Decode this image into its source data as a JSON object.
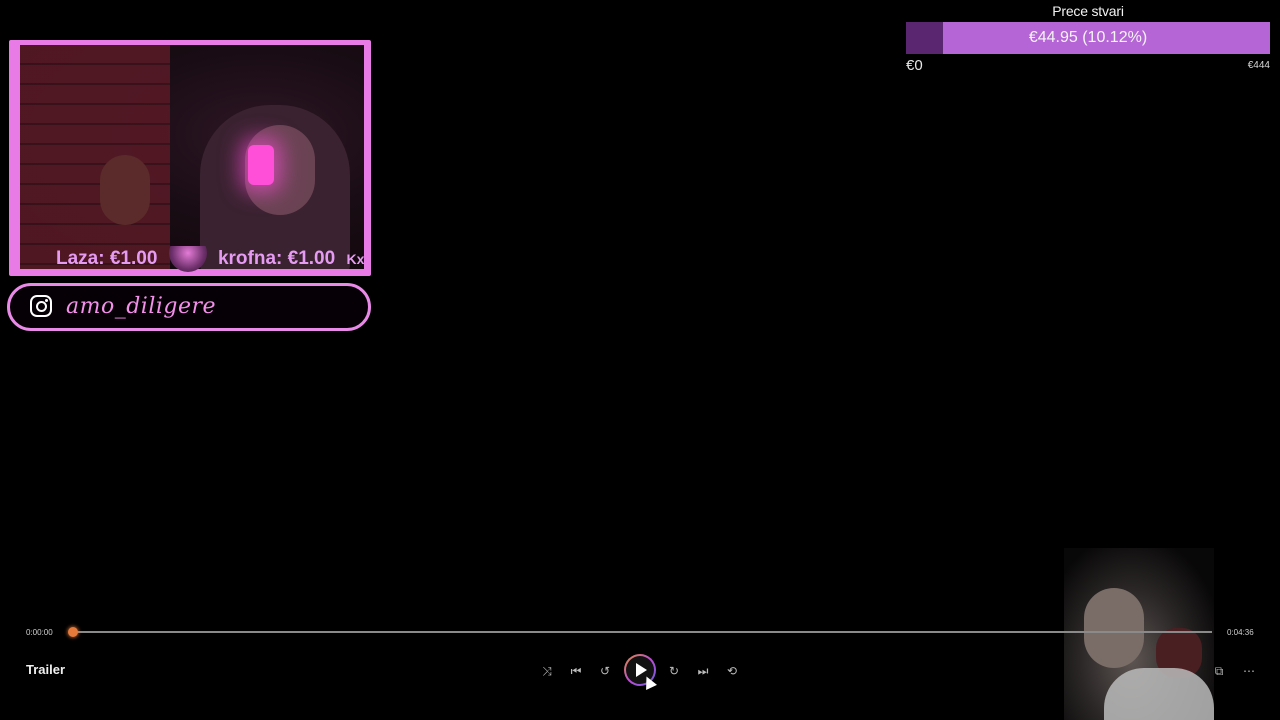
{
  "goal": {
    "title": "Prece stvari",
    "progress_label": "€44.95 (10.12%)",
    "progress_fraction": 0.1012,
    "min_label": "€0",
    "max_label": "€444",
    "colors": {
      "fill": "#b565d6",
      "track": "#6b2f82"
    }
  },
  "webcam": {
    "ticker_items": [
      "Laza: €1.00",
      "krofna: €1.00"
    ],
    "ticker_tail": "Kx",
    "frame_color": "#e97be6"
  },
  "social": {
    "icon": "instagram-icon",
    "handle": "amo_diligere"
  },
  "player": {
    "title": "Trailer",
    "current_time": "0:00:00",
    "total_time": "0:04:36",
    "progress_fraction": 0.0,
    "controls": {
      "shuffle": "⤨",
      "previous": "⏮",
      "rewind": "↺",
      "forward": "↻",
      "next": "⏭",
      "repeat": "⟲",
      "mini_player": "⧉",
      "more": "⋯"
    },
    "accent": "#e57a3b"
  }
}
